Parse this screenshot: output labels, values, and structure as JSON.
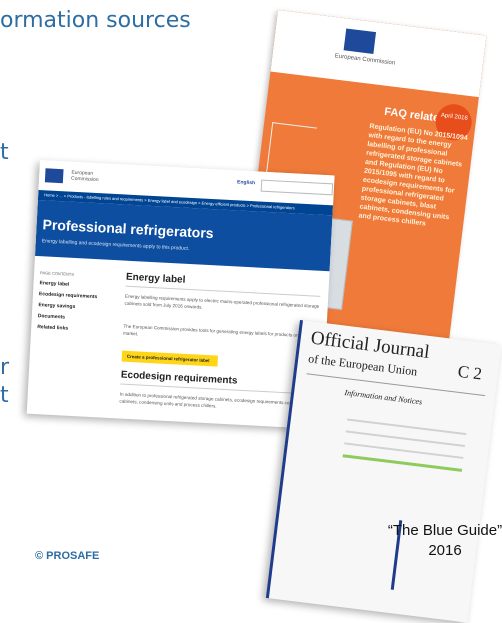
{
  "slide": {
    "heading": "ormation sources",
    "fragments": [
      "t",
      "r",
      "t"
    ],
    "copyright": "© PROSAFE"
  },
  "faq_doc": {
    "logo_text": "European Commission",
    "title": "FAQ related to",
    "body": "Regulation (EU) No 2015/1094 with regard to the energy labelling of professional refrigerated storage cabinets and Regulation (EU) No 2015/1095 with regard to ecodesign requirements for professional refrigerated storage cabinets, blast cabinets, condensing units and process chillers",
    "badge": "April 2016"
  },
  "web_page": {
    "org": "European Commission",
    "language": "English",
    "breadcrumbs": "Home > ... > Products - labelling rules and requirements > Energy label and ecodesign > Energy efficient products > Professional refrigerators",
    "title": "Professional refrigerators",
    "subtitle": "Energy labelling and ecodesign requirements apply to this product.",
    "sidebar": {
      "heading": "PAGE CONTENTS",
      "items": [
        "Energy label",
        "Ecodesign requirements",
        "Energy savings",
        "Documents",
        "Related links"
      ]
    },
    "energy_label": {
      "heading": "Energy label",
      "para1": "Energy labelling requirements apply to electric mains-operated professional refrigerated storage cabinets sold from July 2016 onwards.",
      "para2": "The European Commission provides tools for generating energy labels for products on the EU market.",
      "button": "Create a professional refrigerator label"
    },
    "ecodesign": {
      "heading": "Ecodesign requirements",
      "para": "In addition to professional refrigerated storage cabinets, ecodesign requirements cover blast cabinets, condensing units and process chillers."
    }
  },
  "official_journal": {
    "title_line1": "Official Journal",
    "title_line2": "of the European Union",
    "series": "C 2",
    "section": "Information and Notices"
  },
  "blue_guide": {
    "line1": "“The Blue  Guide”",
    "line2": "2016"
  },
  "colors": {
    "accent": "#2e6da4",
    "ec_blue": "#0e4ea0",
    "faq_orange": "#ef7a3a",
    "button_yellow": "#ffd617"
  }
}
